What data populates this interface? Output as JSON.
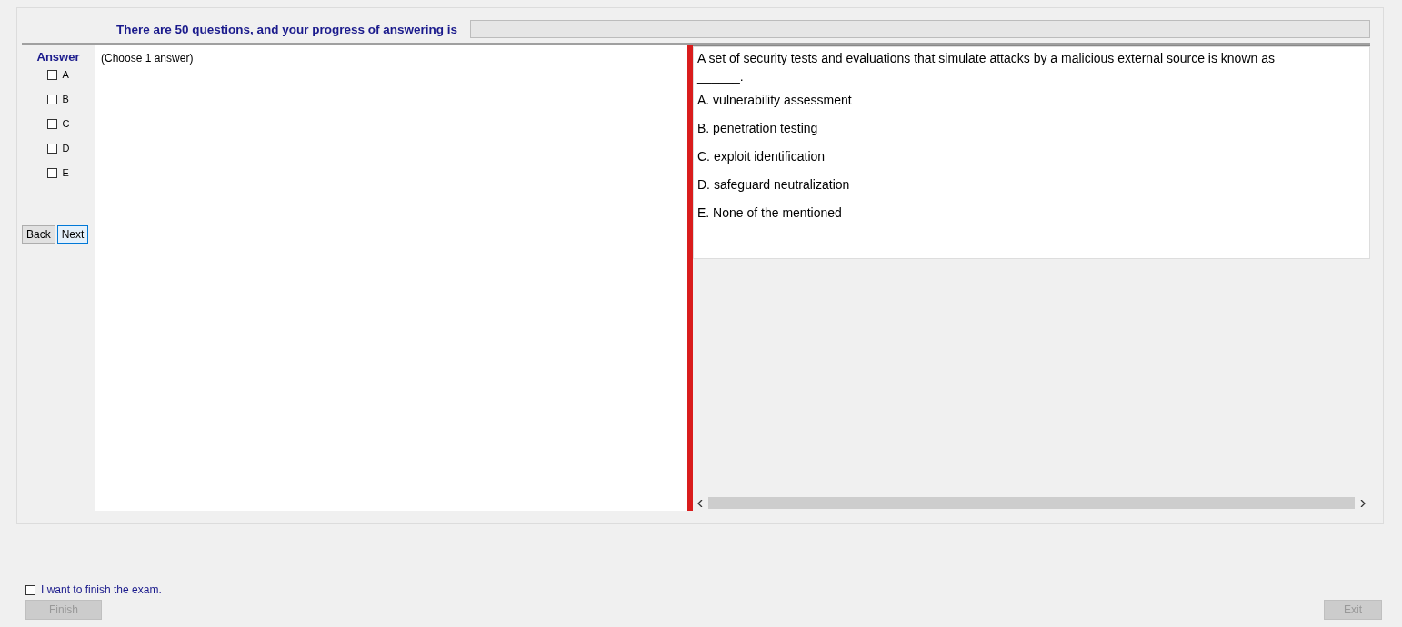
{
  "header": {
    "text": "There are 50 questions, and your progress of answering is",
    "progress": {
      "level": 0
    }
  },
  "answer_panel": {
    "title": "Answer",
    "options": [
      {
        "label": "A",
        "checked": false
      },
      {
        "label": "B",
        "checked": false
      },
      {
        "label": "C",
        "checked": false
      },
      {
        "label": "D",
        "checked": false
      },
      {
        "label": "E",
        "checked": false
      }
    ],
    "buttons": [
      {
        "label": "Back",
        "selected": false
      },
      {
        "label": "Next",
        "selected": true
      }
    ]
  },
  "instruction": "(Choose 1 answer)",
  "question": {
    "text": "A set of security tests and evaluations that simulate attacks by a malicious external source is known as ______.",
    "choices": [
      "A.  vulnerability assessment",
      "B.  penetration testing",
      "C.  exploit identification",
      "D.  safeguard neutralization",
      "E.  None of the mentioned"
    ]
  },
  "footer": {
    "finish_checkbox": {
      "label": "I want to finish the exam.",
      "checked": false
    },
    "finish_button": {
      "label": "Finish",
      "disabled": true
    },
    "exit_button": {
      "label": "Exit",
      "disabled": true
    }
  }
}
